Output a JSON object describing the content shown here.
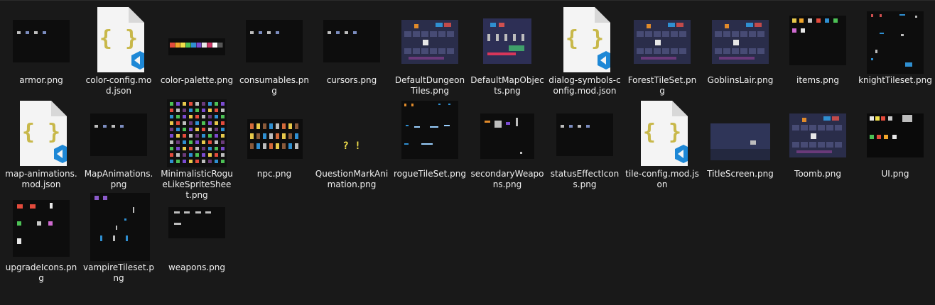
{
  "files": [
    {
      "label": "armor.png",
      "type": "sprite",
      "icon": "armor-thumbnail-icon"
    },
    {
      "label": "color-config.mod.json",
      "type": "json",
      "icon": "json-file-icon"
    },
    {
      "label": "color-palette.png",
      "type": "palette",
      "icon": "palette-thumbnail-icon"
    },
    {
      "label": "consumables.png",
      "type": "sprite",
      "icon": "consumables-thumbnail-icon"
    },
    {
      "label": "cursors.png",
      "type": "sprite",
      "icon": "cursors-thumbnail-icon"
    },
    {
      "label": "DefaultDungeonTiles.png",
      "type": "tileset",
      "icon": "tileset-thumbnail-icon"
    },
    {
      "label": "DefaultMapObjects.png",
      "type": "objects",
      "icon": "map-objects-thumbnail-icon"
    },
    {
      "label": "dialog-symbols-config.mod.json",
      "type": "json",
      "icon": "json-file-icon"
    },
    {
      "label": "ForestTileSet.png",
      "type": "tileset",
      "icon": "tileset-thumbnail-icon"
    },
    {
      "label": "GoblinsLair.png",
      "type": "tileset",
      "icon": "tileset-thumbnail-icon"
    },
    {
      "label": "items.png",
      "type": "items",
      "icon": "items-thumbnail-icon"
    },
    {
      "label": "knightTileset.png",
      "type": "knight",
      "icon": "knight-thumbnail-icon"
    },
    {
      "label": "map-animations.mod.json",
      "type": "json",
      "icon": "json-file-icon"
    },
    {
      "label": "MapAnimations.png",
      "type": "sprite",
      "icon": "animations-thumbnail-icon"
    },
    {
      "label": "MinimalisticRogueLikeSpriteSheet.png",
      "type": "sheet",
      "icon": "spritesheet-thumbnail-icon"
    },
    {
      "label": "npc.png",
      "type": "npc",
      "icon": "npc-thumbnail-icon"
    },
    {
      "label": "QuestionMarkAnimation.png",
      "type": "qmark",
      "icon": "question-mark-thumbnail-icon"
    },
    {
      "label": "rogueTileSet.png",
      "type": "rogue",
      "icon": "rogue-thumbnail-icon"
    },
    {
      "label": "secondaryWeapons.png",
      "type": "weapons2",
      "icon": "secondary-weapons-thumbnail-icon"
    },
    {
      "label": "statusEffectIcons.png",
      "type": "sprite",
      "icon": "status-effect-thumbnail-icon"
    },
    {
      "label": "tile-config.mod.json",
      "type": "json",
      "icon": "json-file-icon"
    },
    {
      "label": "TitleScreen.png",
      "type": "title",
      "icon": "title-screen-thumbnail-icon"
    },
    {
      "label": "Toomb.png",
      "type": "tileset",
      "icon": "tileset-thumbnail-icon"
    },
    {
      "label": "UI.png",
      "type": "ui",
      "icon": "ui-thumbnail-icon"
    },
    {
      "label": "upgradeIcons.png",
      "type": "upgrade",
      "icon": "upgrade-icons-thumbnail-icon"
    },
    {
      "label": "vampireTileset.png",
      "type": "vampire",
      "icon": "vampire-thumbnail-icon"
    },
    {
      "label": "weapons.png",
      "type": "weapons",
      "icon": "weapons-thumbnail-icon"
    }
  ],
  "colors": {
    "background": "#191919",
    "thumb_bg": "#0d0d0d",
    "json_accent": "#c8b84a",
    "vscode_blue": "#1e88d6",
    "tile_dark": "#2a2d4a",
    "tile_mid": "#474b74"
  }
}
